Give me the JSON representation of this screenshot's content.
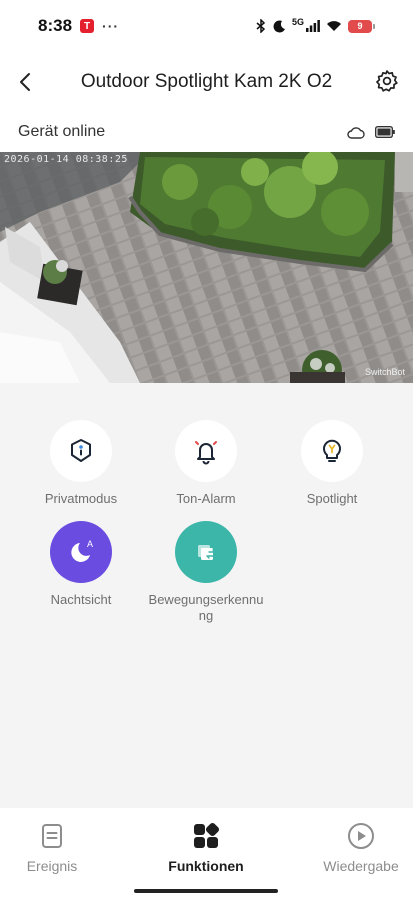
{
  "status_bar": {
    "time": "8:38",
    "app_badge": "T",
    "more": "···",
    "network": "5G",
    "battery_level": "9"
  },
  "header": {
    "title": "Outdoor Spotlight Kam 2K O2"
  },
  "device": {
    "status_text": "Gerät online"
  },
  "video": {
    "timestamp": "2026-01-14 08:38:25",
    "watermark": "SwitchBot"
  },
  "features": [
    {
      "label": "Privatmodus",
      "icon": "privacy-shield-icon"
    },
    {
      "label": "Ton-Alarm",
      "icon": "bell-alarm-icon"
    },
    {
      "label": "Spotlight",
      "icon": "lightbulb-icon"
    },
    {
      "label": "Nachtsicht",
      "icon": "night-vision-icon",
      "color": "#6a4de0",
      "badge": "A"
    },
    {
      "label": "Bewegungserkennu",
      "label2": "ng",
      "icon": "motion-detection-icon",
      "color": "#3bb6a8"
    }
  ],
  "bottom_nav": {
    "items": [
      {
        "label": "Ereignis",
        "icon": "event-list-icon",
        "active": false
      },
      {
        "label": "Funktionen",
        "icon": "functions-grid-icon",
        "active": true
      },
      {
        "label": "Wiedergabe",
        "icon": "playback-icon",
        "active": false
      }
    ]
  },
  "colors": {
    "accent_purple": "#6a4de0",
    "accent_teal": "#3bb6a8",
    "background": "#f4f4f4"
  }
}
